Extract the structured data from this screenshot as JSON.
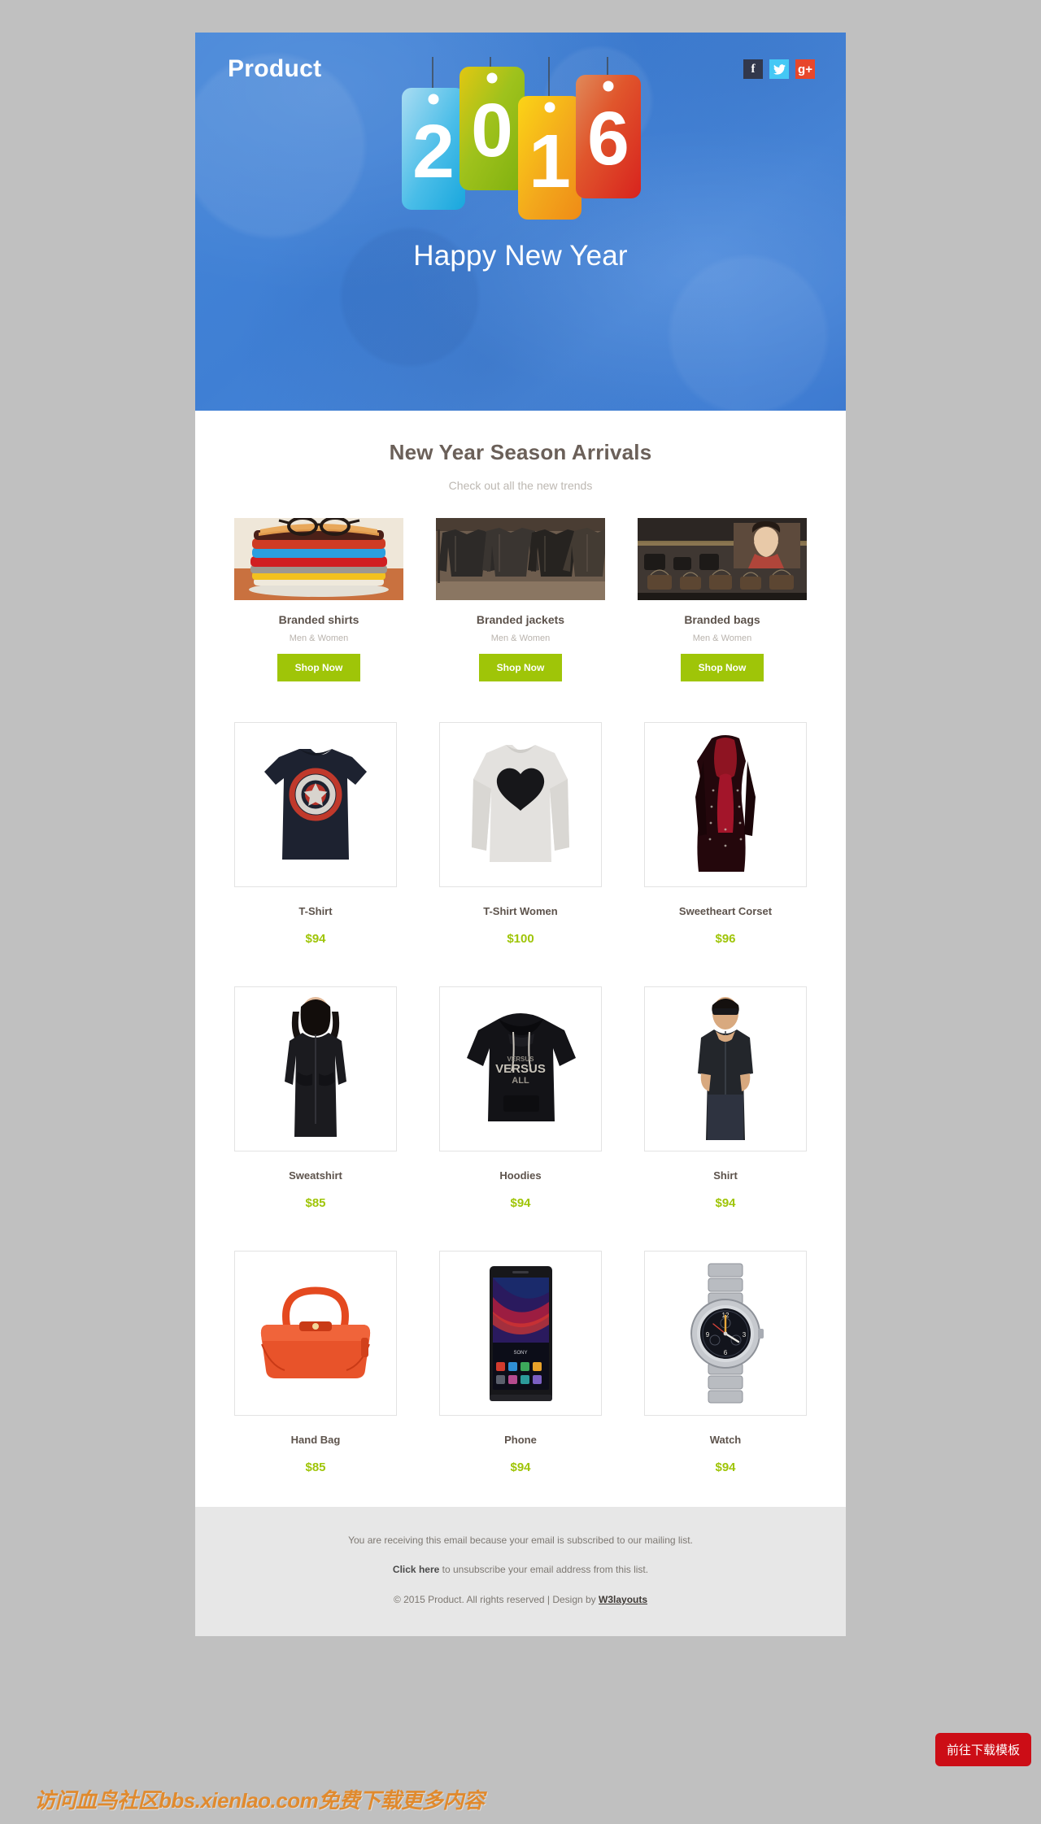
{
  "header": {
    "brand": "Product",
    "hero_title": "Happy New Year",
    "hero_year": "2016",
    "social": [
      {
        "name": "facebook",
        "glyph": "f"
      },
      {
        "name": "twitter",
        "glyph": "✒"
      },
      {
        "name": "google-plus",
        "glyph": "g+"
      }
    ]
  },
  "section": {
    "title": "New Year Season Arrivals",
    "subtitle": "Check out all the new trends"
  },
  "categories": [
    {
      "name": "Branded shirts",
      "sub": "Men & Women",
      "cta": "Shop Now",
      "image": "stack-of-folded-shirts-with-glasses"
    },
    {
      "name": "Branded jackets",
      "sub": "Men & Women",
      "cta": "Shop Now",
      "image": "rack-of-leather-jackets"
    },
    {
      "name": "Branded bags",
      "sub": "Men & Women",
      "cta": "Shop Now",
      "image": "handbag-store-display"
    }
  ],
  "products": [
    [
      {
        "name": "T-Shirt",
        "price": "$94",
        "image": "navy-tshirt-captain-america-shield"
      },
      {
        "name": "T-Shirt Women",
        "price": "$100",
        "image": "grey-longsleeve-with-black-heart"
      },
      {
        "name": "Sweetheart Corset",
        "price": "$96",
        "image": "dark-red-corset-dress"
      }
    ],
    [
      {
        "name": "Sweatshirt",
        "price": "$85",
        "image": "black-hooded-sweatshirt-on-model"
      },
      {
        "name": "Hoodies",
        "price": "$94",
        "image": "black-graphic-hoodie"
      },
      {
        "name": "Shirt",
        "price": "$94",
        "image": "man-in-black-shirt-sunglasses"
      }
    ],
    [
      {
        "name": "Hand Bag",
        "price": "$85",
        "image": "orange-leather-handbag"
      },
      {
        "name": "Phone",
        "price": "$94",
        "image": "black-smartphone"
      },
      {
        "name": "Watch",
        "price": "$94",
        "image": "silver-chronograph-wristwatch"
      }
    ]
  ],
  "footer": {
    "line1": "You are receiving this email because your email is subscribed to our mailing list.",
    "unsubscribe_link": "Click here",
    "unsubscribe_rest": " to unsubscribe your email address from this list.",
    "copyright_pre": "© 2015 Product. All rights reserved | Design by ",
    "designer": "W3layouts"
  },
  "overlay": {
    "watermark": "访问血鸟社区bbs.xienIao.com免费下载更多内容",
    "download_button": "前往下载模板"
  },
  "colors": {
    "hero_blue": "#4a89dc",
    "accent_green": "#9fc508",
    "title_brown": "#6b6059",
    "page_bg": "#c0c0c0",
    "footer_bg": "#e7e7e7",
    "download_red": "#cc0d16",
    "watermark_orange": "#e08a2e"
  }
}
